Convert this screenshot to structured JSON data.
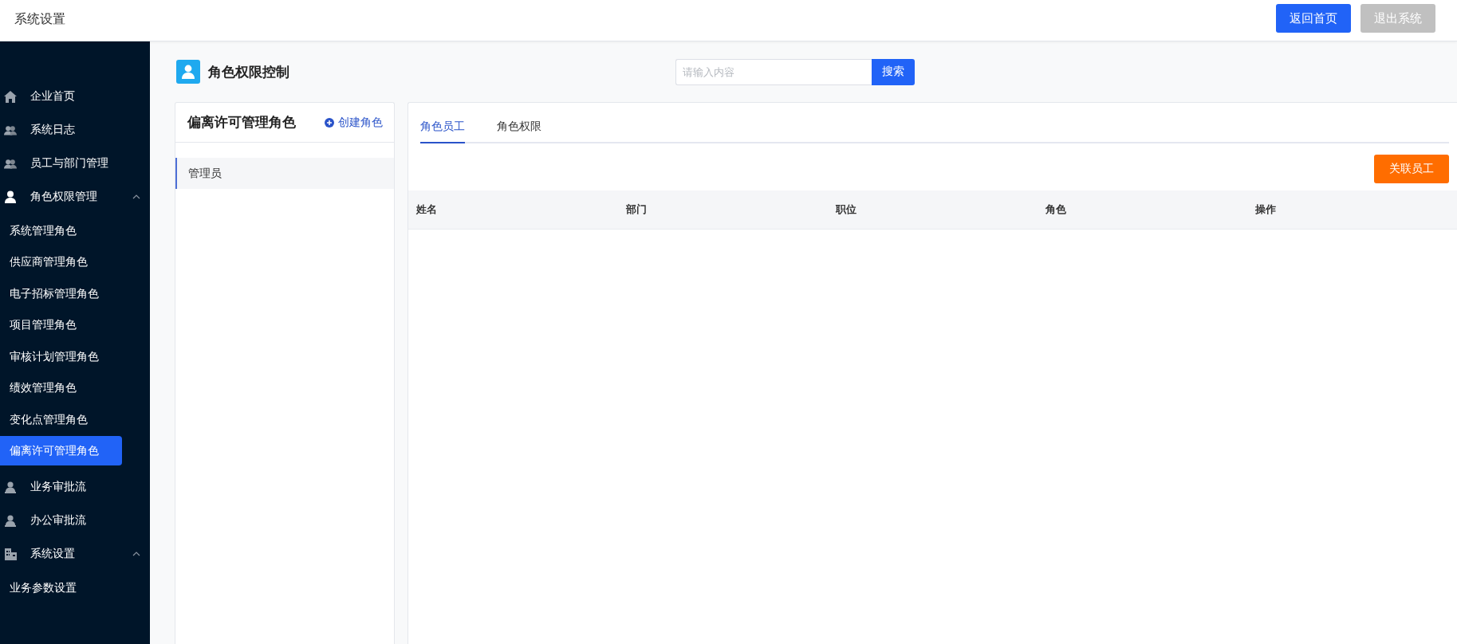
{
  "header": {
    "title": "系统设置",
    "buttons": [
      {
        "label": "返回首页",
        "disabled": false
      },
      {
        "label": "退出系统",
        "disabled": true
      }
    ]
  },
  "sidebar": {
    "items": [
      {
        "label": "企业首页",
        "selected": false
      },
      {
        "label": "系统日志",
        "selected": false
      },
      {
        "label": "员工与部门管理",
        "selected": false
      },
      {
        "label": "角色权限管理",
        "selected": false,
        "expanded": true,
        "children": [
          {
            "label": "系统管理角色",
            "selected": false
          },
          {
            "label": "供应商管理角色",
            "selected": false
          },
          {
            "label": "电子招标管理角色",
            "selected": false
          },
          {
            "label": "项目管理角色",
            "selected": false
          },
          {
            "label": "审核计划管理角色",
            "selected": false
          },
          {
            "label": "绩效管理角色",
            "selected": false
          },
          {
            "label": "变化点管理角色",
            "selected": false
          },
          {
            "label": "偏离许可管理角色",
            "selected": true
          }
        ]
      },
      {
        "label": "业务审批流",
        "selected": false
      },
      {
        "label": "办公审批流",
        "selected": false
      },
      {
        "label": "系统设置",
        "selected": false,
        "expanded": true,
        "children": [
          {
            "label": "业务参数设置",
            "selected": false
          }
        ]
      }
    ]
  },
  "page_title": "角色权限控制",
  "search": {
    "placeholder": "请输入内容",
    "button": "搜索"
  },
  "role_panel": {
    "title": "偏离许可管理角色",
    "create_link": "创建角色",
    "roles": [
      {
        "label": "管理员",
        "selected": true
      }
    ]
  },
  "tabs": [
    {
      "label": "角色员工",
      "selected": true
    },
    {
      "label": "角色权限",
      "selected": false
    }
  ],
  "link_button": "关联员工",
  "table": {
    "columns": [
      "姓名",
      "部门",
      "职位",
      "角色",
      "操作"
    ]
  }
}
